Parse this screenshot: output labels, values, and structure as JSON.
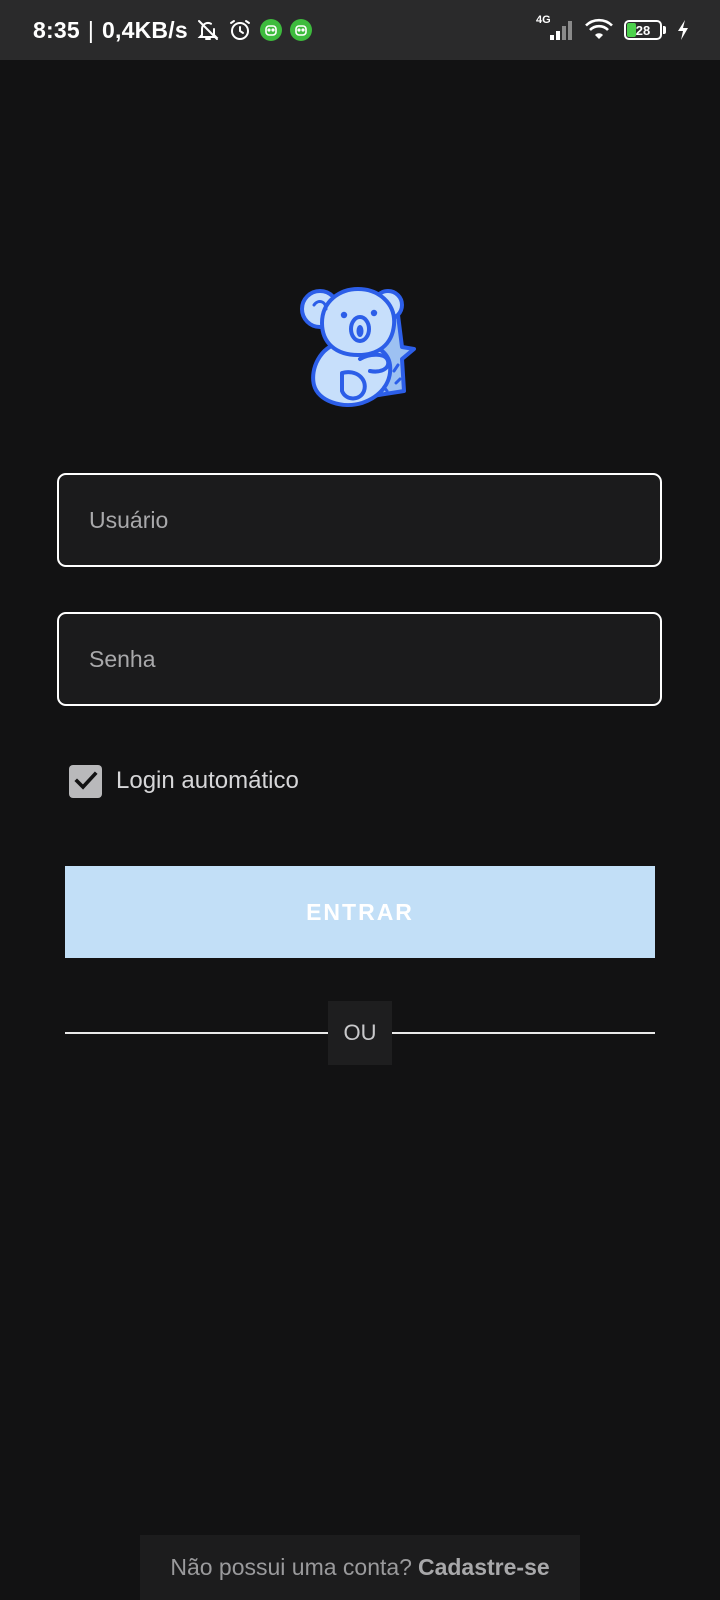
{
  "status_bar": {
    "time": "8:35",
    "separator": "|",
    "speed": "0,4KB/s",
    "network": "4G",
    "battery": "28",
    "battery_level": 0.28,
    "icons": [
      "bell-off-icon",
      "alarm-icon",
      "app-notification-icon",
      "app-notification-icon",
      "signal-icon",
      "wifi-icon",
      "battery-icon",
      "charging-icon"
    ]
  },
  "logo": {
    "icon": "koala-logo-icon"
  },
  "form": {
    "username": {
      "placeholder": "Usuário",
      "value": ""
    },
    "password": {
      "placeholder": "Senha",
      "value": ""
    },
    "auto_login": {
      "label": "Login automático",
      "checked": true
    },
    "submit_label": "ENTRAR",
    "divider_label": "OU"
  },
  "footer": {
    "question": "Não possui uma conta?",
    "link": "Cadastre-se"
  },
  "colors": {
    "background": "#121213",
    "status_bar": "#2a2a2b",
    "button": "#c2dff7",
    "logo_accent": "#2c5ee8",
    "logo_fill": "#c7dffb"
  }
}
